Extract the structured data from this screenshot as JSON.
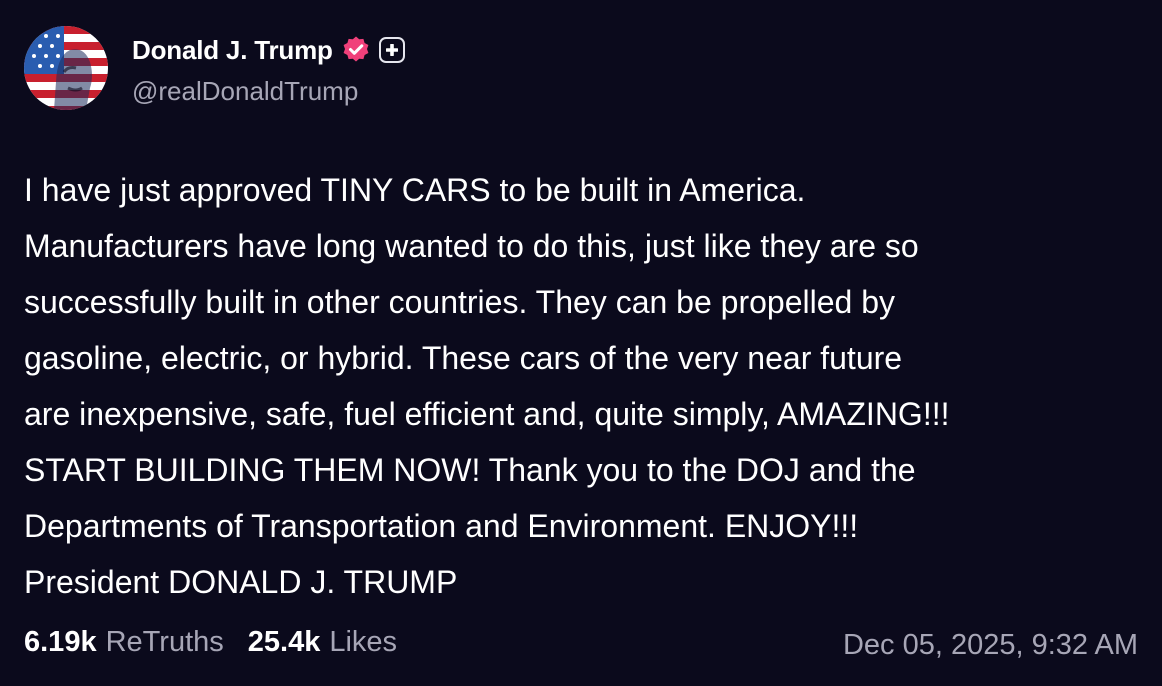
{
  "author": {
    "display_name": "Donald J. Trump",
    "handle": "@realDonaldTrump"
  },
  "post": {
    "lines": [
      "I have just approved TINY CARS to be built in America.",
      "Manufacturers have long wanted to do this, just like they are so",
      "successfully built in other countries. They can be propelled by",
      "gasoline, electric, or hybrid. These cars of the very near future",
      "are inexpensive, safe, fuel efficient and, quite simply, AMAZING!!!",
      "START BUILDING THEM NOW! Thank you to the DOJ and the",
      "Departments of Transportation and Environment. ENJOY!!!",
      "President DONALD J. TRUMP"
    ]
  },
  "stats": {
    "retruths_count": "6.19k",
    "retruths_label": "ReTruths",
    "likes_count": "25.4k",
    "likes_label": "Likes",
    "timestamp": "Dec 05, 2025, 9:32 AM"
  },
  "icons": {
    "verified": "verified-badge-icon",
    "plus": "plus-badge-icon"
  },
  "colors": {
    "background": "#0b0a1c",
    "verified_badge": "#f0407a",
    "muted_text": "#a7a6b6"
  }
}
